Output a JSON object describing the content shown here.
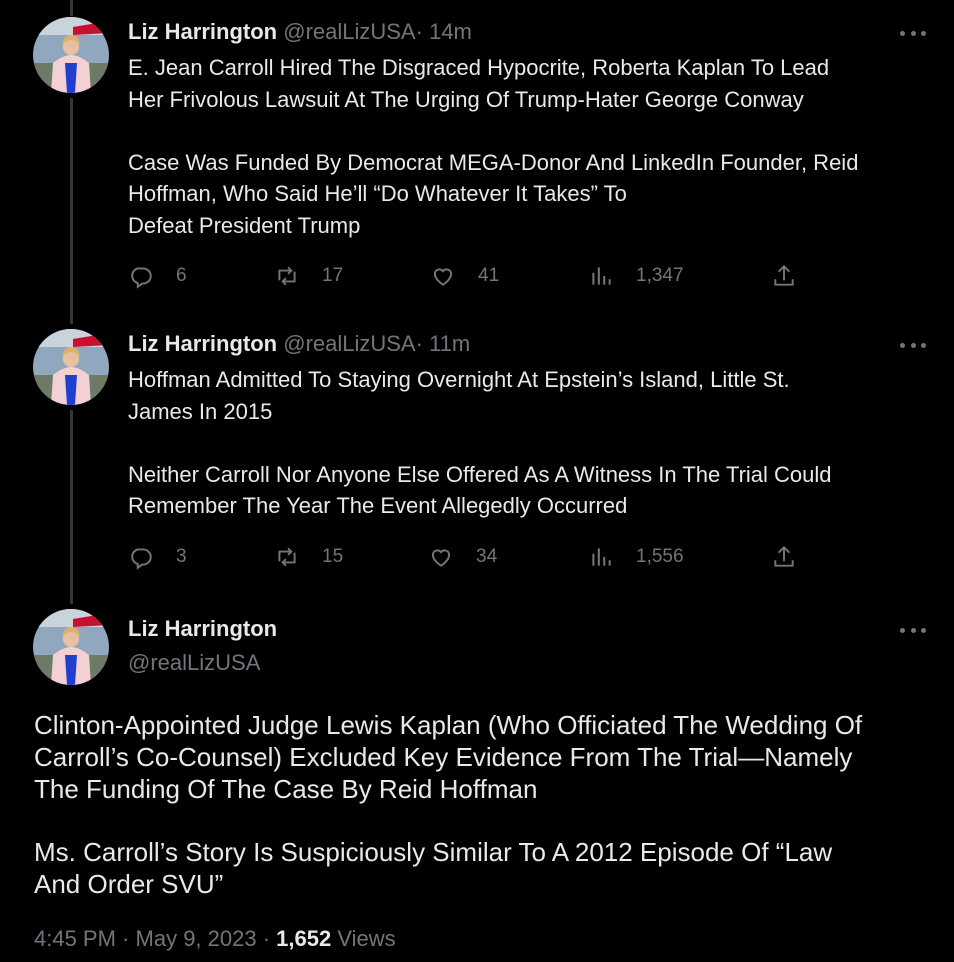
{
  "colors": {
    "background": "#000000",
    "text": "#e7e9ea",
    "secondary": "#71767b",
    "thread_line": "#333639"
  },
  "icons": {
    "reply": "reply-icon",
    "retweet": "retweet-icon",
    "like": "heart-icon",
    "views": "views-icon",
    "share": "share-icon",
    "more": "more-icon"
  },
  "tweets": [
    {
      "name": "Liz Harrington",
      "handle": "@realLizUSA",
      "sep": "·",
      "time": "14m",
      "text": "E. Jean Carroll Hired The Disgraced Hypocrite, Roberta Kaplan To Lead\nHer Frivolous Lawsuit At The Urging Of Trump-Hater George Conway\n\nCase Was Funded By Democrat MEGA-Donor And LinkedIn Founder, Reid\nHoffman, Who Said He’ll “Do Whatever It Takes” To\nDefeat President Trump",
      "replies": "6",
      "retweets": "17",
      "likes": "41",
      "views": "1,347"
    },
    {
      "name": "Liz Harrington",
      "handle": "@realLizUSA",
      "sep": "·",
      "time": "11m",
      "text": "Hoffman Admitted To Staying Overnight At Epstein’s Island, Little St.\nJames In 2015\n\nNeither Carroll Nor Anyone Else Offered As A Witness In The Trial Could\nRemember The Year The Event Allegedly Occurred",
      "replies": "3",
      "retweets": "15",
      "likes": "34",
      "views": "1,556"
    }
  ],
  "main": {
    "name": "Liz Harrington",
    "handle": "@realLizUSA",
    "text": "Clinton-Appointed Judge Lewis Kaplan (Who Officiated The Wedding Of\nCarroll’s Co-Counsel) Excluded Key Evidence From The Trial—Namely\nThe Funding Of The Case By Reid Hoffman\n\nMs. Carroll’s Story Is Suspiciously Similar To A 2012 Episode Of “Law\nAnd Order SVU”",
    "time": "4:45 PM",
    "sep1": "·",
    "date": "May 9, 2023",
    "sep2": "·",
    "views_count": "1,652",
    "views_label": "Views"
  }
}
